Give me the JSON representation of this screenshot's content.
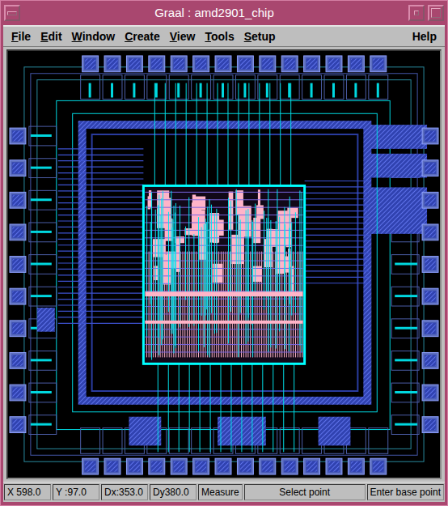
{
  "window": {
    "title": "Graal : amd2901_chip"
  },
  "menus": [
    {
      "label": "File",
      "mnemonic": true
    },
    {
      "label": "Edit",
      "mnemonic": true
    },
    {
      "label": "Window",
      "mnemonic": true
    },
    {
      "label": "Create",
      "mnemonic": true
    },
    {
      "label": "View",
      "mnemonic": true
    },
    {
      "label": "Tools",
      "mnemonic": true
    },
    {
      "label": "Setup",
      "mnemonic": true
    }
  ],
  "help_menu": {
    "label": "Help",
    "mnemonic": false
  },
  "status_bar": [
    {
      "text": "X 598.0",
      "kind": "coordinate"
    },
    {
      "text": "Y :97.0",
      "kind": "coordinate"
    },
    {
      "text": "Dx:353.0",
      "kind": "coordinate"
    },
    {
      "text": "Dy380.0",
      "kind": "coordinate"
    },
    {
      "text": "Measure",
      "kind": "mode"
    },
    {
      "text": "Select point",
      "kind": "message"
    },
    {
      "text": "Enter base point",
      "kind": "prompt"
    }
  ]
}
